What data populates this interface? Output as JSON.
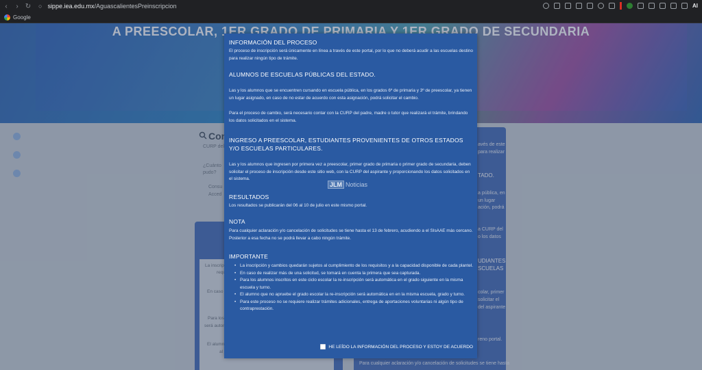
{
  "browser": {
    "url_domain": "sippe.iea.edu.mx",
    "url_path": "/AguascalientesPreinscripcion",
    "bookmark_label": "Google",
    "ai_label": "AI"
  },
  "background": {
    "banner_title": "A PREESCOLAR, 1ER GRADO DE PRIMARIA Y 1ER GRADO DE SECUNDARIA",
    "search_title": "Con",
    "sub1": "CURP del",
    "sub2": "¿Cuánto",
    "sub3": "pudo?",
    "bullet1": "Consu",
    "bullet2": "Acced",
    "left_lines": [
      "La inscrip",
      "requ",
      "En caso",
      "Para los",
      "será autom",
      "El alumn",
      "al"
    ],
    "right_lines": [
      "avés de este",
      "para realizar",
      "TADO.",
      "a pública, en",
      "un lugar",
      "ación, podrá",
      "a CURP del",
      "o los datos",
      "UDIANTES",
      "SCUELAS",
      "colar, primer",
      "solicitar el",
      "del aspirante",
      "reno portal."
    ],
    "bottom_line": "Para cualquier aclaración y/o cancelación de solicitudes se tiene hasta"
  },
  "modal": {
    "h_info": "INFORMACIÓN DEL PROCESO",
    "p_info": "El proceso de inscripción será únicamente en línea a través de este portal, por lo que no deberá acudir a las escuelas destino para realizar ningún tipo de trámite.",
    "h_publicas": "ALUMNOS DE ESCUELAS PÚBLICAS DEL ESTADO.",
    "p_publicas1": "Las y los alumnos que se encuentren cursando en escuela pública, en los grados 6º de primaria y 3º de preescolar, ya tienen un lugar asignado, en caso de no estar de acuerdo con esta asignación, podrá solicitar el cambio.",
    "p_publicas2": "Para el proceso de cambio, será necesario contar con la CURP del padre, madre o tutor que realizará el trámite, brindando los datos solicitados en el sistema.",
    "h_ingreso": "INGRESO A PREESCOLAR, ESTUDIANTES PROVENIENTES DE OTROS ESTADOS Y/O ESCUELAS PARTICULARES.",
    "p_ingreso": "Las y los alumnos que ingresen por primera vez a preescolar, primer grado de primaria o primer grado de secundaria, deben solicitar el proceso de inscripción desde este sitio web, con la CURP del aspirante y proporcionando los datos solicitados en el sistema.",
    "watermark_box": "JLM",
    "watermark_text": "Noticias",
    "h_resultados": "RESULTADOS",
    "p_resultados": "Los resultados se publicarán del 06 al 10 de julio en este mismo portal.",
    "h_nota": "NOTA",
    "p_nota": "Para cualquier aclaración y/o cancelación de solicitudes se tiene hasta el 13 de febrero, acudiendo a el SIsAAE más cercano. Posterior a esa fecha no se podrá llevar a cabo ningún trámite.",
    "h_importante": "IMPORTANTE",
    "importante_items": [
      "La inscripción y cambios quedarán sujetos al cumplimiento de los requisitos y a la capacidad disponible de cada plantel.",
      "En caso de realizar más de una solicitud, se tomará en cuenta la primera que sea capturada.",
      "Para los alumnos inscritos en este ciclo escolar la re-inscripción será automática en el grado siguiente en la misma escuela y turno.",
      "El alumno que no apruebe el grado escolar la re-inscripción será automática en en la misma escuela, grado y turno.",
      "Para este proceso no se requiere realizar trámites adicionales, entrega de aportaciones voluntarias ni algún tipo de contraprestación."
    ],
    "agree_label": "HE LEÍDO LA INFORMACIÓN DEL PROCESO Y ESTOY DE ACUERDO"
  }
}
